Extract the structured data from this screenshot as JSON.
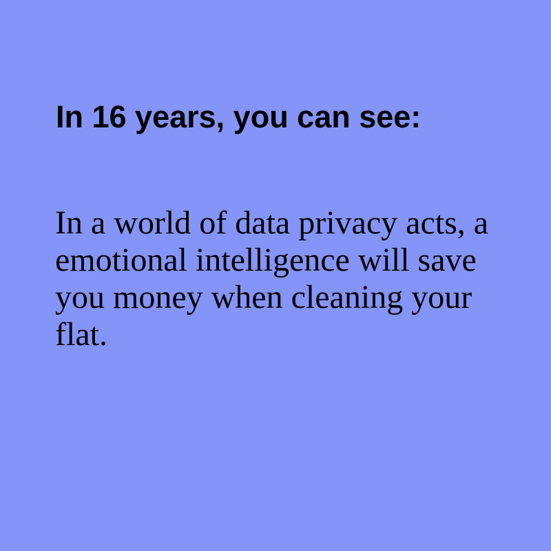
{
  "background_color": "#8594f8",
  "text_color": "#000000",
  "heading": "In 16 years, you can see:",
  "body": "In a world of data privacy acts, a emotional intelligence will save you money when cleaning your flat."
}
